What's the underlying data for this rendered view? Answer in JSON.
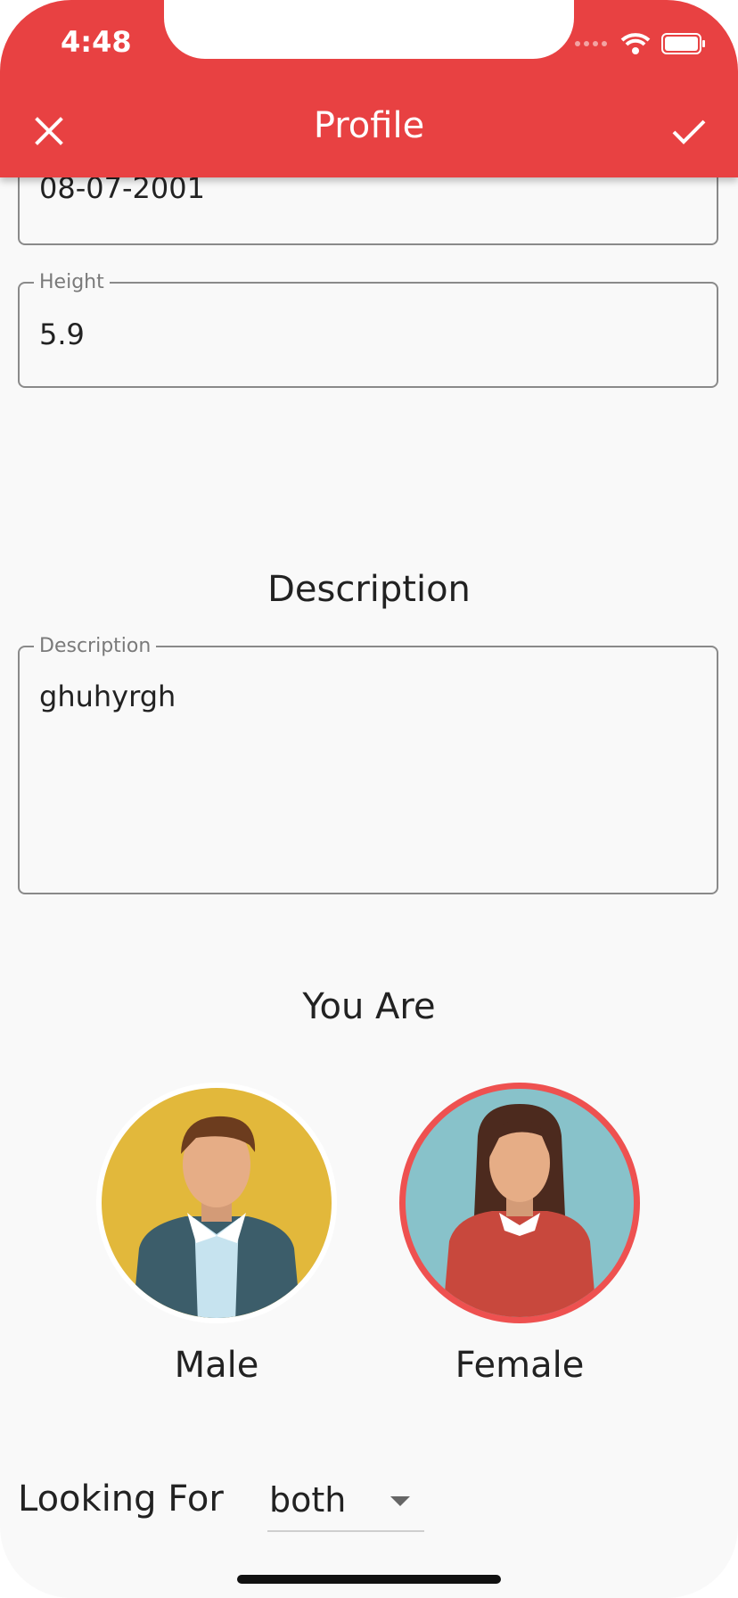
{
  "status_bar": {
    "time": "4:48"
  },
  "appbar": {
    "title": "Profile",
    "close_icon": "close-icon",
    "confirm_icon": "check-icon"
  },
  "fields": {
    "dob": {
      "value": "08-07-2001"
    },
    "height": {
      "label": "Height",
      "value": "5.9"
    },
    "description": {
      "label": "Description",
      "value": "ghuhyrgh"
    }
  },
  "sections": {
    "description_title": "Description",
    "you_are_title": "You Are"
  },
  "gender": {
    "male_label": "Male",
    "female_label": "Female",
    "selected": "Female",
    "selected_color": "#ee5150"
  },
  "looking_for": {
    "label": "Looking For",
    "value": "both"
  },
  "colors": {
    "accent": "#e84142",
    "background": "#f9f9f9"
  }
}
